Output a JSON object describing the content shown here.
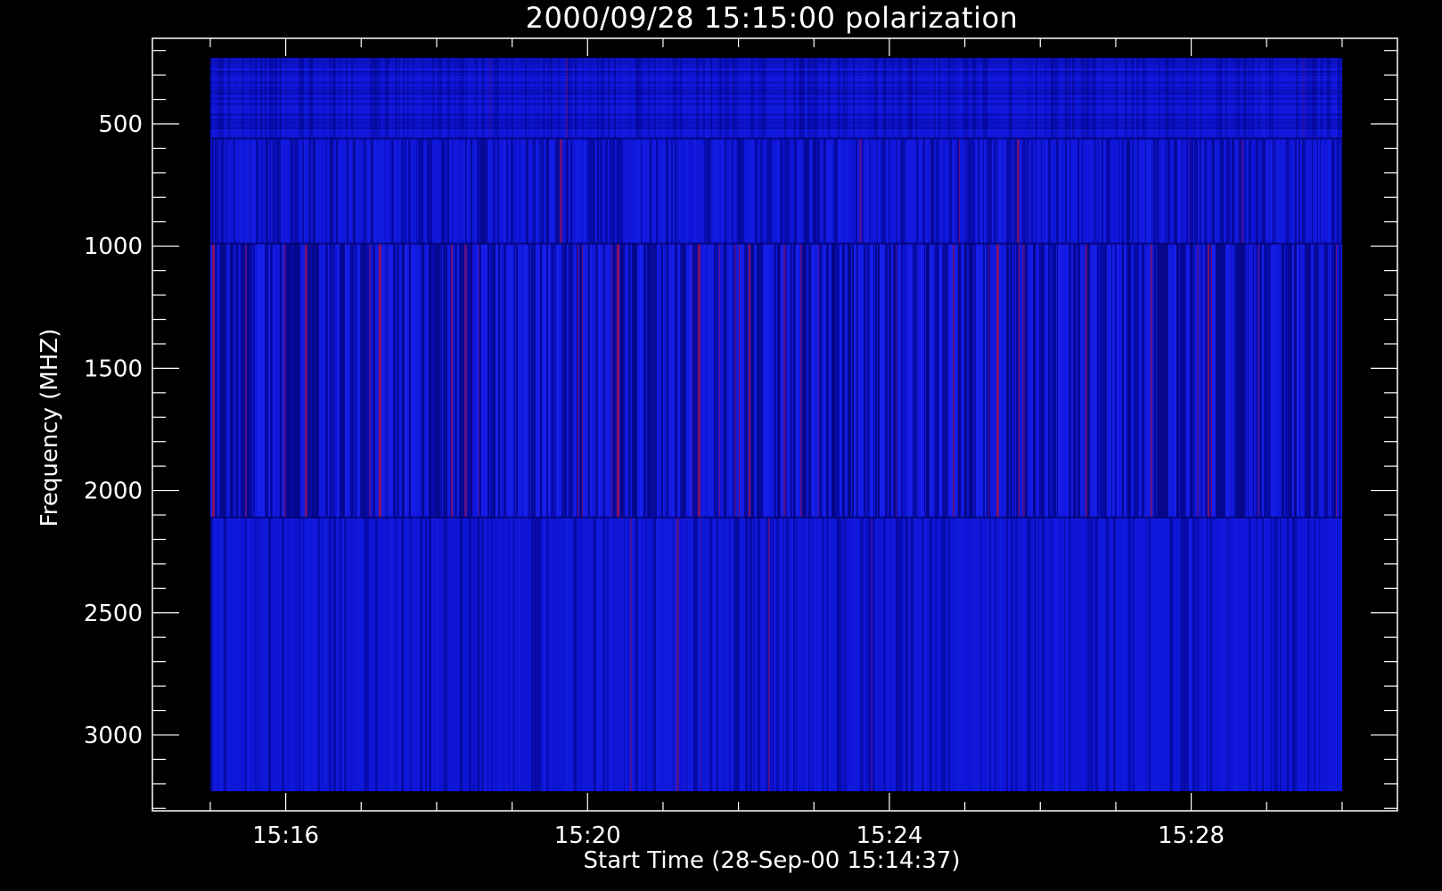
{
  "chart_data": {
    "type": "heatmap",
    "title": "2000/09/28 15:15:00 polarization",
    "xlabel": "Start Time (28-Sep-00 15:14:37)",
    "ylabel": "Frequency (MHZ)",
    "x_tick_labels": [
      "15:16",
      "15:20",
      "15:24",
      "15:28"
    ],
    "x_tick_values_min": [
      16,
      20,
      24,
      28
    ],
    "x_range_min": [
      14.233,
      30.733
    ],
    "x_data_range_min": [
      15.0,
      30.0
    ],
    "y_tick_labels": [
      "500",
      "1000",
      "1500",
      "2000",
      "2500",
      "3000"
    ],
    "y_tick_values": [
      500,
      1000,
      1500,
      2000,
      2500,
      3000
    ],
    "y_range": [
      150,
      3310
    ],
    "y_reversed": true,
    "y_data_range": [
      230,
      3230
    ],
    "bands_mhz": [
      [
        230,
        560
      ],
      [
        560,
        990
      ],
      [
        990,
        2110
      ],
      [
        2110,
        3230
      ]
    ],
    "colors": {
      "background": "#000000",
      "axes": "#ffffff",
      "base": "#0a10c8",
      "bright": "#1e28ff",
      "dark": "#040468",
      "hot": "#c81430"
    }
  }
}
